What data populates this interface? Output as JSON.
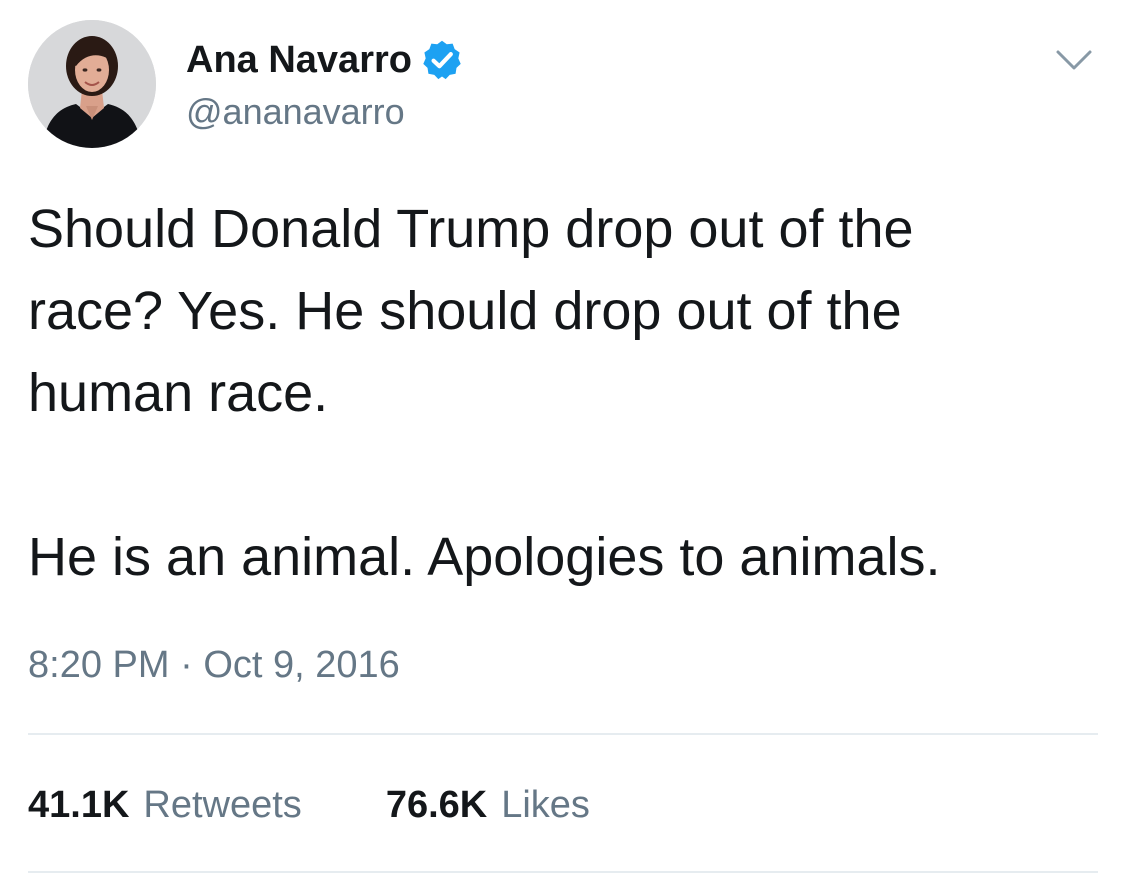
{
  "author": {
    "display_name": "Ana Navarro",
    "handle": "@ananavarro",
    "verified": true,
    "verified_icon": "verified-badge-icon",
    "verified_color": "#1da1f2"
  },
  "menu_icon": "chevron-down-icon",
  "tweet": {
    "paragraph_1": "Should Donald Trump drop out of the\nrace? Yes. He should drop out of the\nhuman race.",
    "paragraph_2": "He is an animal. Apologies to animals."
  },
  "timestamp": {
    "time": "8:20 PM",
    "separator": "·",
    "date": "Oct 9, 2016"
  },
  "stats": {
    "retweets_count": "41.1K",
    "retweets_label": "Retweets",
    "likes_count": "76.6K",
    "likes_label": "Likes"
  },
  "colors": {
    "text_primary": "#14171a",
    "text_secondary": "#657786",
    "divider": "#e6ecf0",
    "accent": "#1da1f2"
  }
}
